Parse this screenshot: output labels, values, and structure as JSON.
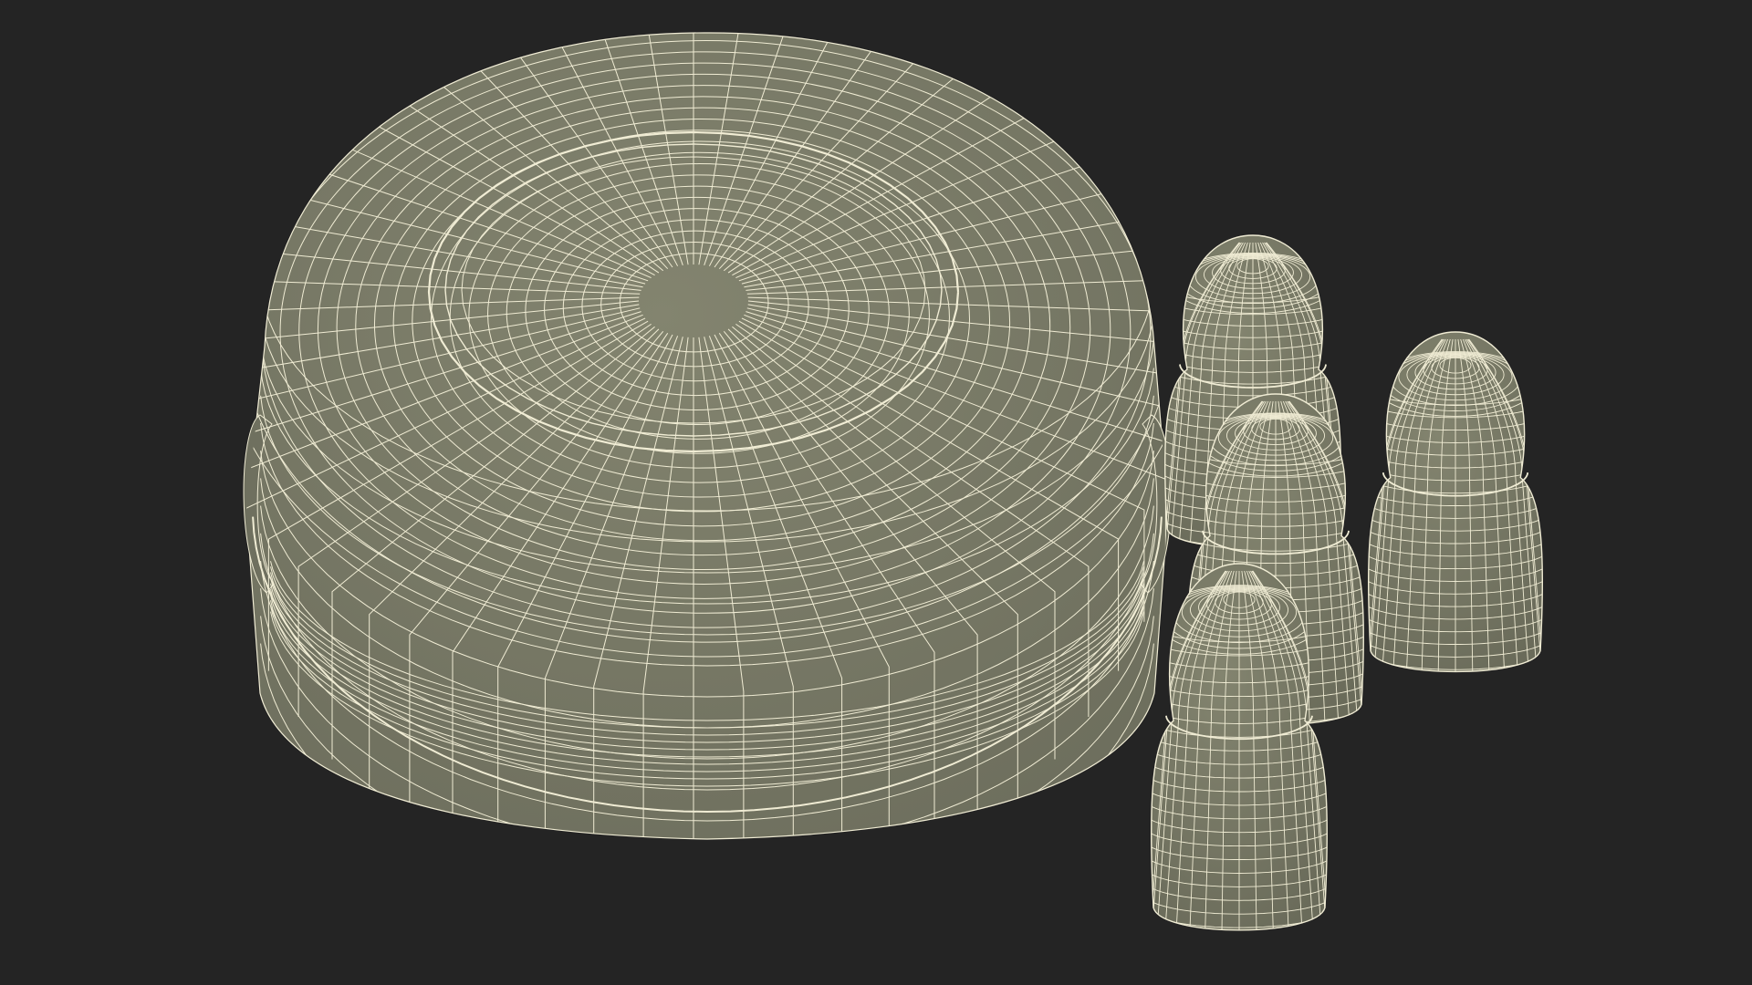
{
  "scene": {
    "background_color": "#242424",
    "mesh_fill_color": "#7a7b69",
    "mesh_shade_color": "#5e5f50",
    "wire_color": "#f0ecd4",
    "objects": [
      {
        "id": "bowl",
        "name": "wireframe-bowl",
        "kind": "bowl"
      },
      {
        "id": "egg-back-left",
        "name": "wireframe-egg-back-left",
        "kind": "egg"
      },
      {
        "id": "egg-back-right",
        "name": "wireframe-egg-back-right",
        "kind": "egg"
      },
      {
        "id": "egg-middle",
        "name": "wireframe-egg-middle",
        "kind": "egg"
      },
      {
        "id": "egg-front",
        "name": "wireframe-egg-front",
        "kind": "egg"
      }
    ]
  }
}
